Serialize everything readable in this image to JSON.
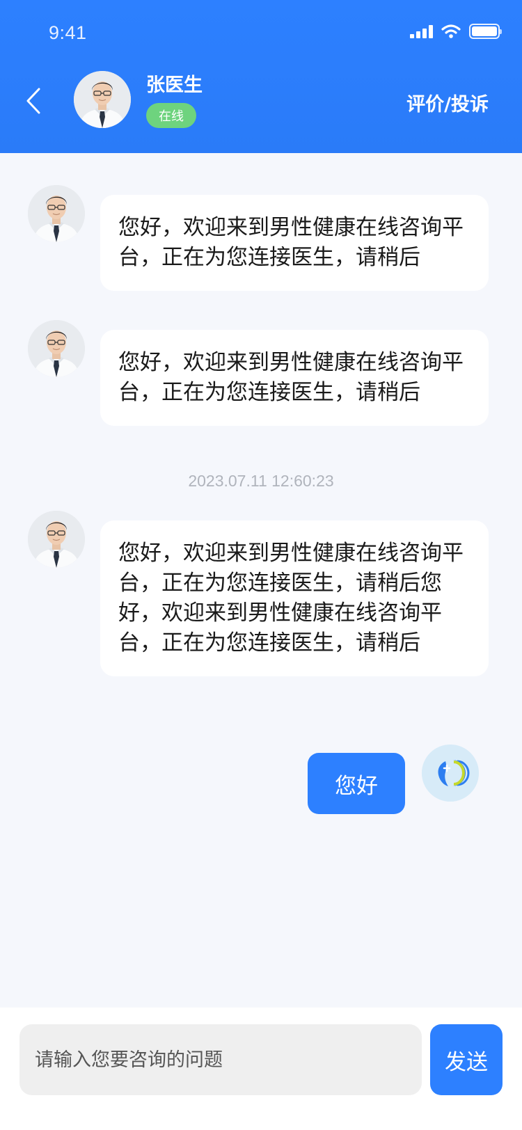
{
  "status_bar": {
    "time": "9:41"
  },
  "header": {
    "doctor_name": "张医生",
    "status": "在线",
    "review_link": "评价/投诉"
  },
  "messages": [
    {
      "sender": "doctor",
      "text": "您好，欢迎来到男性健康在线咨询平台，正在为您连接医生，请稍后"
    },
    {
      "sender": "doctor",
      "text": "您好，欢迎来到男性健康在线咨询平台，正在为您连接医生，请稍后"
    },
    {
      "sender": "doctor",
      "text": "您好，欢迎来到男性健康在线咨询平台，正在为您连接医生，请稍后您好，欢迎来到男性健康在线咨询平台，正在为您连接医生，请稍后"
    },
    {
      "sender": "user",
      "text": "您好"
    }
  ],
  "timestamp": "2023.07.11 12:60:23",
  "input": {
    "placeholder": "请输入您要咨询的问题",
    "value": ""
  },
  "send_label": "发送",
  "colors": {
    "primary": "#2d80ff",
    "online": "#6ed37e",
    "background": "#f5f7fc"
  }
}
